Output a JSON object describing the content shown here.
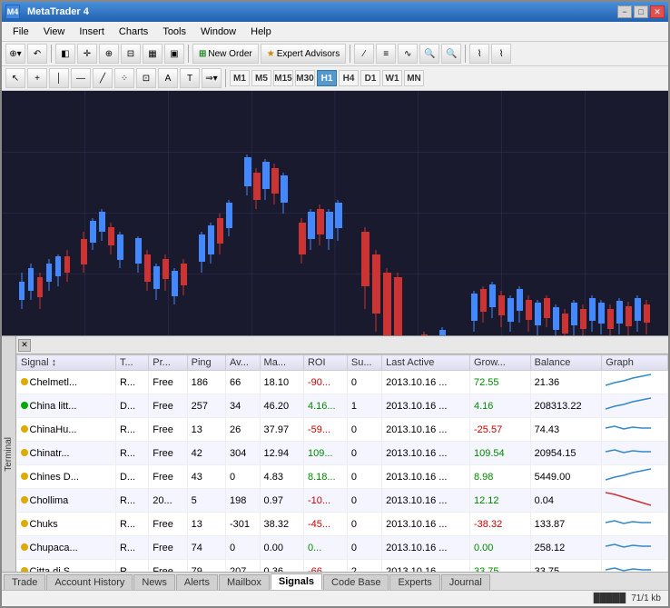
{
  "window": {
    "title": "MetaTrader 4",
    "min_btn": "−",
    "max_btn": "□",
    "close_btn": "✕"
  },
  "menu": {
    "items": [
      "File",
      "View",
      "Insert",
      "Charts",
      "Tools",
      "Window",
      "Help"
    ]
  },
  "toolbar1": {
    "buttons": [
      "⊕",
      "↶",
      "⊞",
      "⊟",
      "✉",
      "☆",
      "♦"
    ],
    "new_order": "New Order",
    "expert_advisors": "Expert Advisors"
  },
  "toolbar2": {
    "cursor_tools": [
      "↖",
      "✛",
      "│",
      "⁻",
      "╱",
      "⁘",
      "⊞",
      "A",
      "T",
      "✦"
    ],
    "timeframes": [
      "M1",
      "M5",
      "M15",
      "M30",
      "H1",
      "H4",
      "D1",
      "W1",
      "MN"
    ]
  },
  "signals_header": {
    "columns": [
      "Signal",
      "T...",
      "Pr...",
      "Ping",
      "Av...",
      "Ma...",
      "ROI",
      "Su...",
      "Last Active",
      "Grow...",
      "Balance",
      "Graph"
    ]
  },
  "signals_rows": [
    {
      "dot": "yellow",
      "name": "Chelmetl...",
      "t": "R...",
      "pr": "Free",
      "ping": 186,
      "av": 66,
      "ma": 18.1,
      "roi": -90,
      "su": 0,
      "la": "2013.10.16 ...",
      "gr": 72.55,
      "bal": 21.36,
      "trend": "up"
    },
    {
      "dot": "green",
      "name": "China litt...",
      "t": "D...",
      "pr": "Free",
      "ping": 257,
      "av": 34,
      "ma": 46.2,
      "roi": 4.16,
      "su": 1,
      "la": "2013.10.16 ...",
      "gr": 4.16,
      "bal": 208313.22,
      "trend": "up"
    },
    {
      "dot": "yellow",
      "name": "ChinaHu...",
      "t": "R...",
      "pr": "Free",
      "ping": 13,
      "av": 26,
      "ma": 37.97,
      "roi": -59,
      "su": 0,
      "la": "2013.10.16 ...",
      "gr": -25.57,
      "bal": 74.43,
      "trend": "flat"
    },
    {
      "dot": "yellow",
      "name": "Chinatr...",
      "t": "R...",
      "pr": "Free",
      "ping": 42,
      "av": 304,
      "ma": 12.94,
      "roi": 109,
      "su": 0,
      "la": "2013.10.16 ...",
      "gr": 109.54,
      "bal": 20954.15,
      "trend": "flat"
    },
    {
      "dot": "yellow",
      "name": "Chines D...",
      "t": "D...",
      "pr": "Free",
      "ping": 43,
      "av": 0,
      "ma": 4.83,
      "roi": 8.18,
      "su": 0,
      "la": "2013.10.16 ...",
      "gr": 8.98,
      "bal": 5449.0,
      "trend": "up"
    },
    {
      "dot": "yellow",
      "name": "Chollima",
      "t": "R...",
      "pr": "20...",
      "ping": 5,
      "av": 198,
      "ma": 0.97,
      "roi": -10,
      "su": 0,
      "la": "2013.10.16 ...",
      "gr": 12.12,
      "bal": 0.04,
      "trend": "down"
    },
    {
      "dot": "yellow",
      "name": "Chuks",
      "t": "R...",
      "pr": "Free",
      "ping": 13,
      "av": -301,
      "ma": 38.32,
      "roi": -45,
      "su": 0,
      "la": "2013.10.16 ...",
      "gr": -38.32,
      "bal": 133.87,
      "trend": "flat"
    },
    {
      "dot": "yellow",
      "name": "Chupaca...",
      "t": "R...",
      "pr": "Free",
      "ping": 74,
      "av": 0,
      "ma": 0.0,
      "roi": 0.0,
      "su": 0,
      "la": "2013.10.16 ...",
      "gr": 0.0,
      "bal": 258.12,
      "trend": "flat"
    },
    {
      "dot": "yellow",
      "name": "Citta di S...",
      "t": "R...",
      "pr": "Free",
      "ping": 79,
      "av": 207,
      "ma": 0.36,
      "roi": -66,
      "su": 2,
      "la": "2013.10.16 ...",
      "gr": 33.75,
      "bal": 33.75,
      "trend": "flat"
    }
  ],
  "tabs": {
    "items": [
      "Trade",
      "Account History",
      "News",
      "Alerts",
      "Mailbox",
      "Signals",
      "Code Base",
      "Experts",
      "Journal"
    ],
    "active": "Signals"
  },
  "status_bar": {
    "bars": "█████",
    "info": "71/1 kb"
  },
  "side_label": "Terminal"
}
